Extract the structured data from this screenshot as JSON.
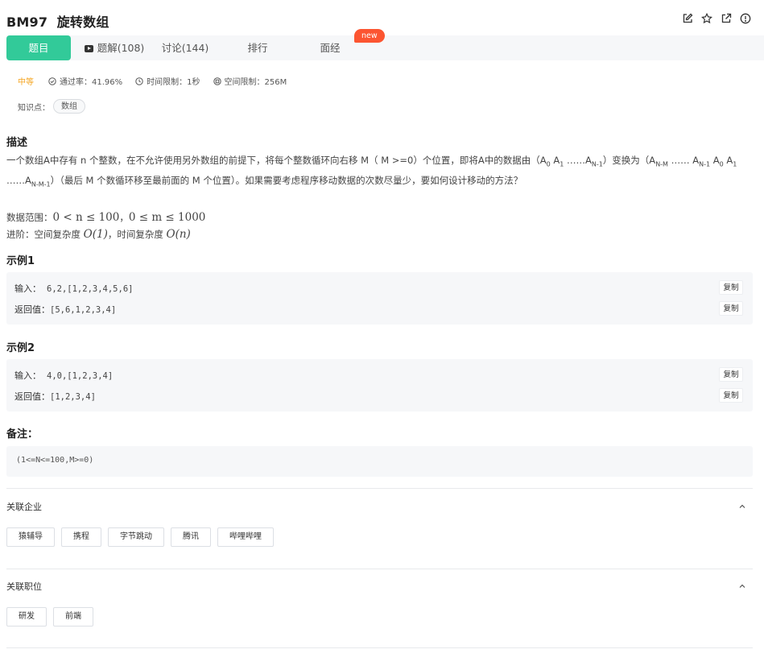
{
  "problem": {
    "id": "BM97",
    "title": "旋转数组"
  },
  "tabs": [
    {
      "label": "题目",
      "active": true
    },
    {
      "label": "题解(108)"
    },
    {
      "label": "讨论(144)"
    },
    {
      "label": "排行"
    },
    {
      "label": "面经",
      "badge": "new"
    }
  ],
  "meta": {
    "difficulty": "中等",
    "pass_rate": "通过率：41.96%",
    "time_limit": "时间限制：1秒",
    "memory_limit": "空间限制：256M"
  },
  "knowledge": {
    "label": "知识点：",
    "tags": [
      "数组"
    ]
  },
  "description": {
    "heading": "描述",
    "para1_a": "一个数组A中存有 n 个整数，在不允许使用另外数组的前提下，将每个整数循环向右移 M（ M >=0）个位置，即将A中的数据由（A",
    "para1_b": "0",
    "para1_c": " A",
    "para1_d": "1",
    "para1_e": " ……A",
    "para1_f": "N-1",
    "para1_g": "）变换为（A",
    "para1_h": "N-M",
    "para1_i": " …… A",
    "para1_j": "N-1",
    "para1_k": " A",
    "para1_l": "0",
    "para1_m": " A",
    "para1_n": "1",
    "para1_o": " ……A",
    "para1_p": "N-M-1",
    "para1_q": "）（最后 M 个数循环移至最前面的 M 个位置）。如果需要考虑程序移动数据的次数尽量少，要如何设计移动的方法？",
    "range_label": "数据范围：",
    "range_math": "0 < n ≤ 100",
    "range_sep": "，",
    "range_math2": "0 ≤ m ≤ 1000",
    "adv_label": "进阶：空间复杂度 ",
    "adv_math1": "O(1)",
    "adv_mid": "，时间复杂度 ",
    "adv_math2": "O(n)"
  },
  "examples": [
    {
      "heading": "示例1",
      "input_label": "输入：",
      "input": "6,2,[1,2,3,4,5,6]",
      "output_label": "返回值：",
      "output": "[5,6,1,2,3,4]",
      "copy": "复制"
    },
    {
      "heading": "示例2",
      "input_label": "输入：",
      "input": "4,0,[1,2,3,4]",
      "output_label": "返回值：",
      "output": "[1,2,3,4]",
      "copy": "复制"
    }
  ],
  "note": {
    "heading": "备注：",
    "text": "(1<=N<=100,M>=0)"
  },
  "companies": {
    "heading": "关联企业",
    "items": [
      "猿辅导",
      "携程",
      "字节跳动",
      "腾讯",
      "哔哩哔哩"
    ]
  },
  "positions": {
    "heading": "关联职位",
    "items": [
      "研发",
      "前端"
    ]
  },
  "icons": [
    "edit-icon",
    "star-icon",
    "external-link-icon",
    "info-icon",
    "check-circle-icon",
    "clock-icon",
    "chip-icon",
    "chevron-up-icon",
    "video-icon"
  ],
  "colors": {
    "accent": "#32ca99",
    "badge": "#fc5531",
    "difficulty": "#f5a623"
  }
}
